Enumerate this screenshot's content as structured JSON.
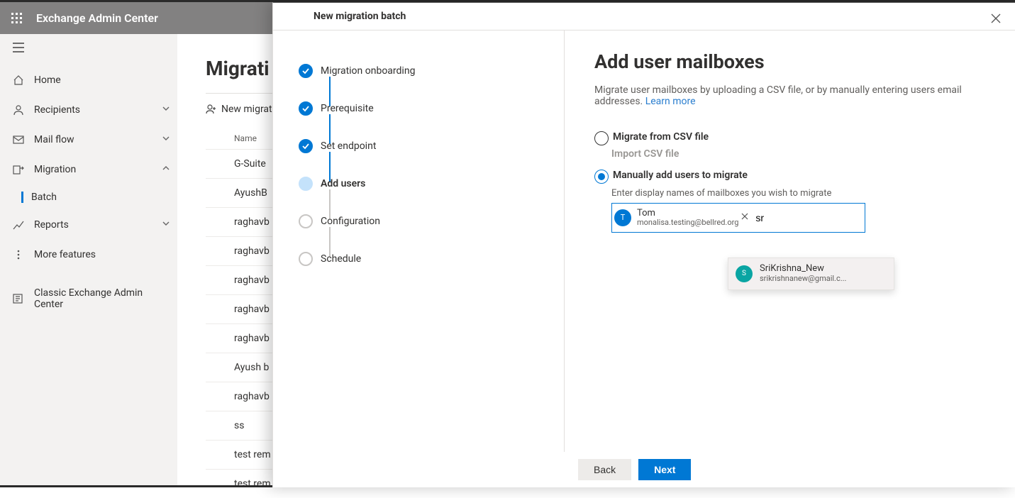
{
  "topbar": {
    "title": "Exchange Admin Center"
  },
  "nav": {
    "home": "Home",
    "recipients": "Recipients",
    "mailflow": "Mail flow",
    "migration": "Migration",
    "batch": "Batch",
    "reports": "Reports",
    "more": "More features",
    "classic": "Classic Exchange Admin Center"
  },
  "page": {
    "title": "Migrati",
    "new_batch": "New migrat",
    "col_name": "Name",
    "rows": [
      "G-Suite",
      "AyushB",
      "raghavb",
      "raghavb",
      "raghavb",
      "raghavb",
      "raghavb",
      "Ayush b",
      "raghavb",
      "ss",
      "test rem",
      "test rem"
    ]
  },
  "panel": {
    "title": "New migration batch",
    "steps": {
      "onboarding": "Migration onboarding",
      "prereq": "Prerequisite",
      "endpoint": "Set endpoint",
      "addusers": "Add users",
      "config": "Configuration",
      "schedule": "Schedule"
    },
    "content": {
      "title": "Add user mailboxes",
      "desc": "Migrate user mailboxes by uploading a CSV file, or by manually entering users email addresses. ",
      "learn_more": "Learn more",
      "radio_csv": "Migrate from CSV file",
      "import_csv": "Import CSV file",
      "radio_manual": "Manually add users to migrate",
      "manual_help": "Enter display names of mailboxes you wish to migrate",
      "chip": {
        "initial": "T",
        "name": "Tom",
        "email": "monalisa.testing@bellred.org"
      },
      "input_value": "sr",
      "suggestion": {
        "initial": "S",
        "name": "SriKrishna_New",
        "email": "srikrishnanew@gmail.c..."
      }
    },
    "footer": {
      "back": "Back",
      "next": "Next"
    }
  }
}
